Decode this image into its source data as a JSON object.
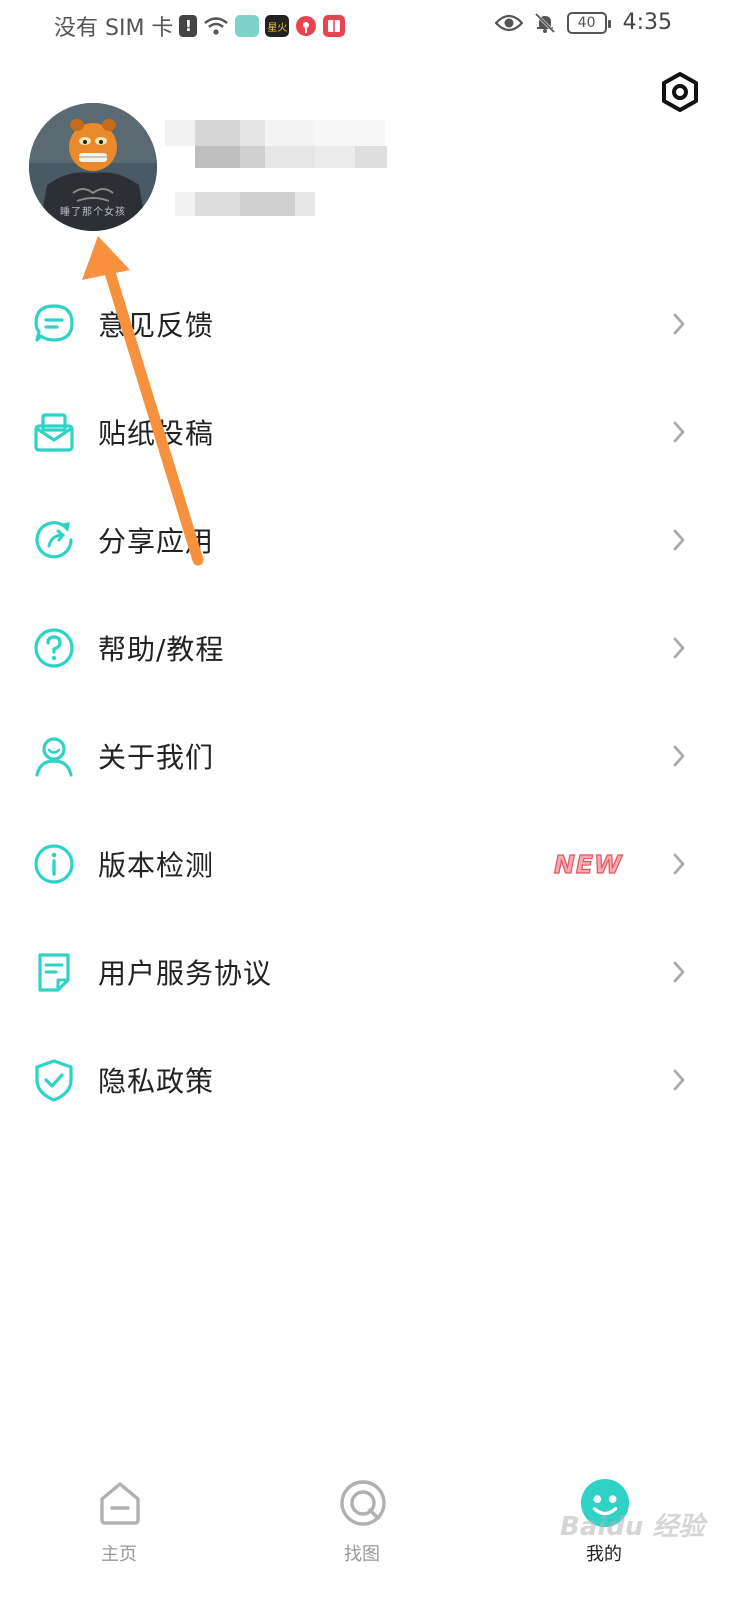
{
  "status_bar": {
    "carrier": "没有 SIM 卡",
    "battery": "40",
    "time": "4:35",
    "app_badge": "星火"
  },
  "profile": {
    "avatar_caption": "睡了那个女孩"
  },
  "menu": {
    "items": [
      {
        "label": "意见反馈",
        "icon": "chat-bubble-icon"
      },
      {
        "label": "贴纸投稿",
        "icon": "mailbox-icon"
      },
      {
        "label": "分享应用",
        "icon": "share-refresh-icon"
      },
      {
        "label": "帮助/教程",
        "icon": "question-icon"
      },
      {
        "label": "关于我们",
        "icon": "person-icon"
      },
      {
        "label": "版本检测",
        "icon": "info-icon",
        "badge": "NEW"
      },
      {
        "label": "用户服务协议",
        "icon": "document-icon"
      },
      {
        "label": "隐私政策",
        "icon": "shield-icon"
      }
    ]
  },
  "tabs": [
    {
      "label": "主页",
      "icon": "home-icon",
      "active": false
    },
    {
      "label": "找图",
      "icon": "search-icon",
      "active": false
    },
    {
      "label": "我的",
      "icon": "mine-face-icon",
      "active": true
    }
  ],
  "watermark": "Baidu 经验",
  "colors": {
    "accent": "#2ed3c6",
    "annotation": "#f7913d",
    "badge": "#e05662"
  }
}
